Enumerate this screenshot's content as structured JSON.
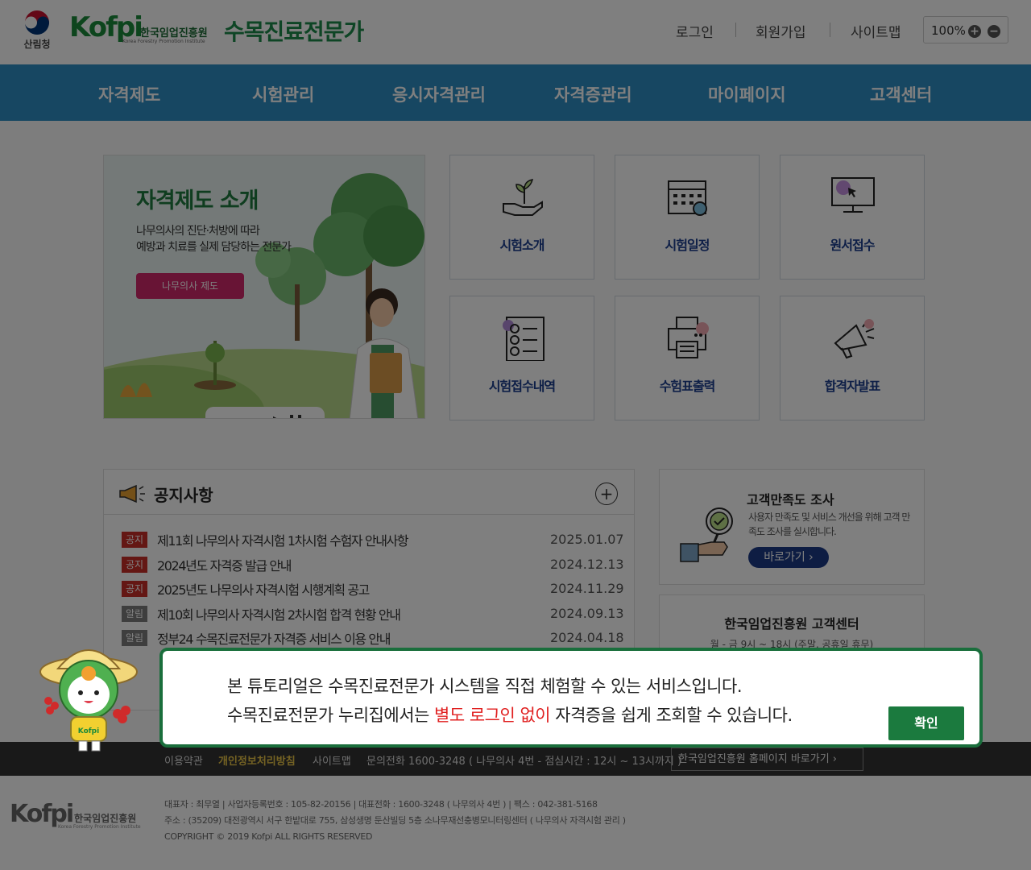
{
  "header": {
    "gov_name": "산림청",
    "brand": "Kofpi",
    "org_name_ko": "한국임업진흥원",
    "org_name_en": "Korea Forestry Promotion Institute",
    "site_title": "수목진료전문가",
    "login": "로그인",
    "signup": "회원가입",
    "sitemap": "사이트맵",
    "zoom": "100%",
    "zoom_in": "+",
    "zoom_out": "−"
  },
  "nav": [
    "자격제도",
    "시험관리",
    "응시자격관리",
    "자격증관리",
    "마이페이지",
    "고객센터"
  ],
  "hero": {
    "title": "자격제도 소개",
    "desc_line1": "나무의사의 진단·처방에 따라",
    "desc_line2": "예방과 치료를 실제 담당하는 전문가",
    "button": "나무의사 제도"
  },
  "tiles": [
    {
      "label": "시험소개",
      "icon": "plant-hand-icon"
    },
    {
      "label": "시험일정",
      "icon": "calendar-icon"
    },
    {
      "label": "원서접수",
      "icon": "monitor-cursor-icon"
    },
    {
      "label": "시험접수내역",
      "icon": "checklist-icon"
    },
    {
      "label": "수험표출력",
      "icon": "printer-icon"
    },
    {
      "label": "합격자발표",
      "icon": "megaphone-icon"
    }
  ],
  "notice": {
    "title": "공지사항",
    "more": "+",
    "items": [
      {
        "tag": "공지",
        "tag_color": "#c92f28",
        "text": "제11회 나무의사 자격시험 1차시험 수험자 안내사항",
        "date": "2025.01.07"
      },
      {
        "tag": "공지",
        "tag_color": "#c92f28",
        "text": "2024년도 자격증 발급 안내",
        "date": "2024.12.13"
      },
      {
        "tag": "공지",
        "tag_color": "#c92f28",
        "text": "2025년도 나무의사 자격시험 시행계획 공고",
        "date": "2024.11.29"
      },
      {
        "tag": "알림",
        "tag_color": "#7d7d7d",
        "text": "제10회 나무의사 자격시험 2차시험 합격 현황 안내",
        "date": "2024.09.13"
      },
      {
        "tag": "알림",
        "tag_color": "#7d7d7d",
        "text": "정부24 수목진료전문가 자격증 서비스 이용 안내",
        "date": "2024.04.18"
      }
    ]
  },
  "survey": {
    "title": "고객만족도 조사",
    "desc": "사용자 만족도 및 서비스 개선을 위해 고객 만족도 조사를 실시합니다.",
    "button": "바로가기 ›"
  },
  "customer_center": {
    "title": "한국임업진흥원 고객센터",
    "hours": "월 - 금 9시 ~ 18시 (주말, 공휴일 휴무)"
  },
  "footer_bar": {
    "terms": "이용약관",
    "privacy": "개인정보처리방침",
    "sitemap": "사이트맵",
    "phone": "문의전화 1600-3248 ( 나무의사 4번 - 점심시간 : 12시 ~ 13시까지 )",
    "homepage": "한국임업진흥원 홈페이지 바로가기  ›"
  },
  "footer": {
    "info_line1": "대표자 : 최무열 | 사업자등록번호 : 105-82-20156 | 대표전화 : 1600-3248 ( 나무의사 4번 ) | 팩스 : 042-381-5168",
    "info_line2": "주소 : (35209) 대전광역시 서구 한밭대로 755, 삼성생명 둔산빌딩 5층 소나무재선충병모니터링센터 ( 나무의사 자격시험 관리 )",
    "copyright": "COPYRIGHT © 2019 Kofpi ALL RIGHTS RESERVED"
  },
  "modal": {
    "line1": "본 튜토리얼은 수목진료전문가 시스템을 직접 체험할 수 있는 서비스입니다.",
    "line2_pre": "수목진료전문가 누리집에서는 ",
    "line2_highlight": "별도 로그인 없이",
    "line2_post": " 자격증을 쉽게 조회할 수 있습니다.",
    "confirm": "확인",
    "mascot_badge": "Kofpi"
  },
  "colors": {
    "nav": "#2f8ec4",
    "brand_green": "#1d8a4a",
    "notice_red": "#c92f28",
    "confirm_green": "#1b7a3e",
    "highlight_red": "#e02020"
  }
}
